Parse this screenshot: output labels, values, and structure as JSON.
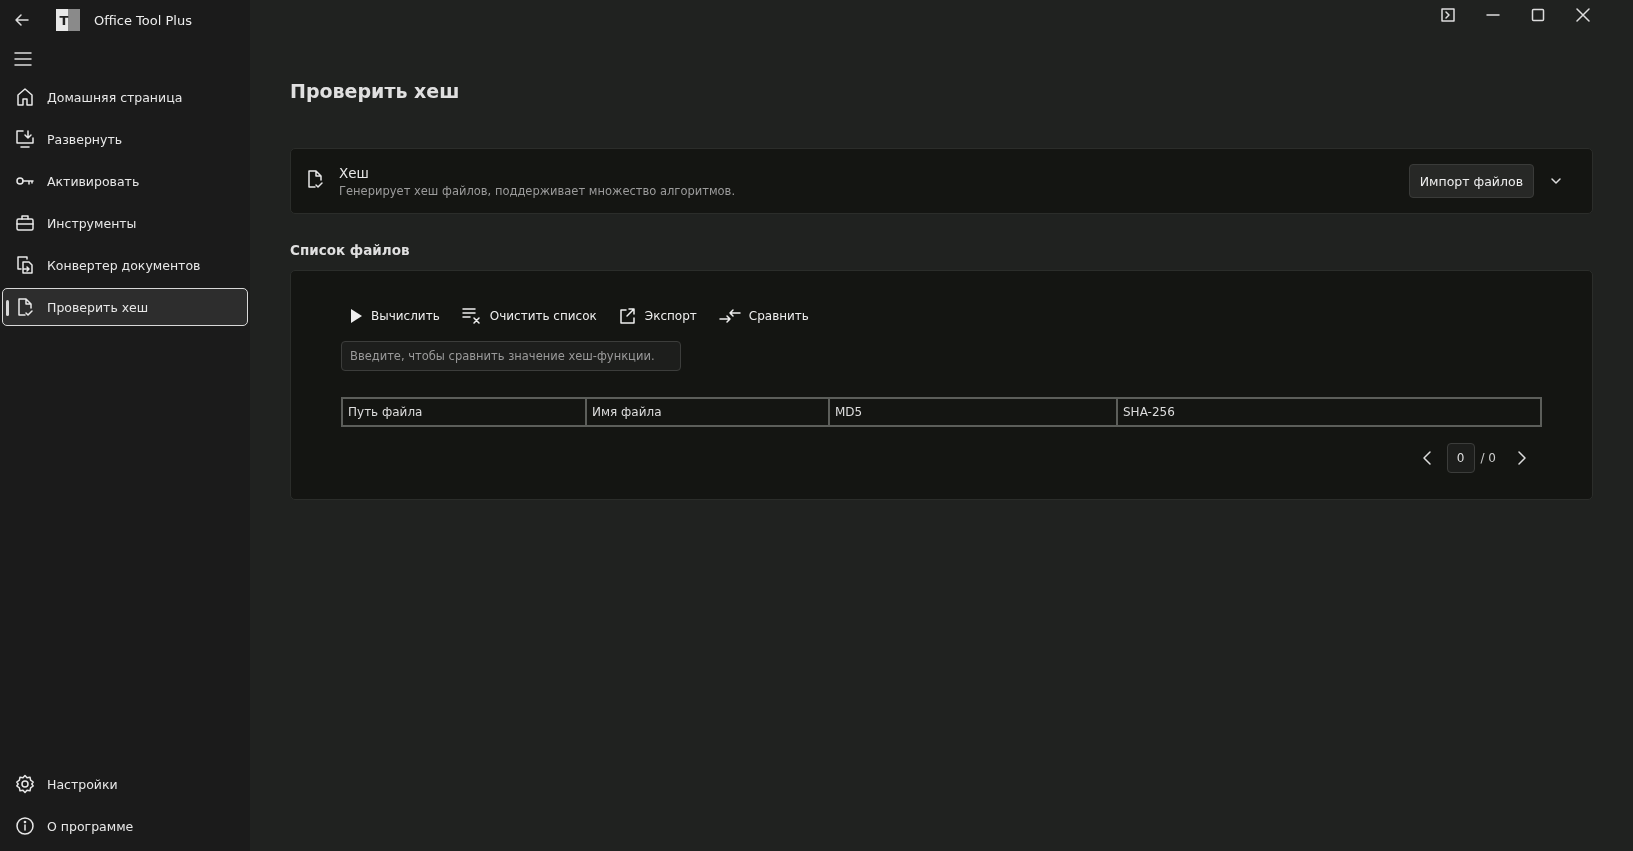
{
  "window": {
    "title": "Office Tool Plus",
    "logo_text": "T"
  },
  "sidebar": {
    "items": [
      {
        "label": "Домашняя страница",
        "selected": false
      },
      {
        "label": "Развернуть",
        "selected": false
      },
      {
        "label": "Активировать",
        "selected": false
      },
      {
        "label": "Инструменты",
        "selected": false
      },
      {
        "label": "Конвертер документов",
        "selected": false
      },
      {
        "label": "Проверить хеш",
        "selected": true
      }
    ],
    "footer_items": [
      {
        "label": "Настройки",
        "selected": false
      },
      {
        "label": "О программе",
        "selected": false
      }
    ]
  },
  "page": {
    "title": "Проверить хеш"
  },
  "hash_card": {
    "title": "Хеш",
    "description": "Генерирует хеш файлов, поддерживает множество алгоритмов.",
    "button": "Импорт файлов",
    "expanded": false
  },
  "file_list": {
    "title": "Список файлов",
    "toolbar": [
      {
        "label": "Вычислить"
      },
      {
        "label": "Очистить список"
      },
      {
        "label": "Экспорт"
      },
      {
        "label": "Сравнить"
      }
    ],
    "compare_field": {
      "placeholder": "Введите, чтобы сравнить значение хеш-функции."
    },
    "table": {
      "columns": [
        "Путь файла",
        "Имя файла",
        "MD5",
        "SHA-256"
      ]
    },
    "pager": {
      "page": "0",
      "total": "/ 0"
    }
  }
}
